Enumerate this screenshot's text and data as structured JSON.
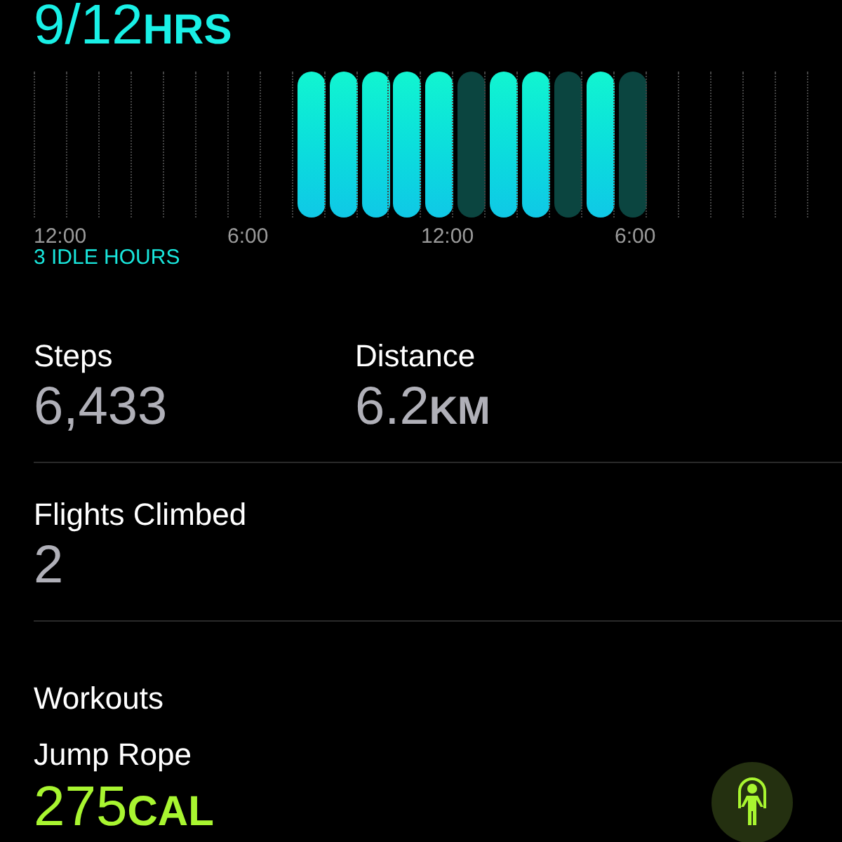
{
  "stand": {
    "value": "9/12",
    "unit": "HRS",
    "hours": [
      {
        "stood": false,
        "idle": false
      },
      {
        "stood": false,
        "idle": false
      },
      {
        "stood": false,
        "idle": false
      },
      {
        "stood": false,
        "idle": false
      },
      {
        "stood": false,
        "idle": false
      },
      {
        "stood": false,
        "idle": false
      },
      {
        "stood": false,
        "idle": false
      },
      {
        "stood": false,
        "idle": false
      },
      {
        "stood": true,
        "idle": false
      },
      {
        "stood": true,
        "idle": false
      },
      {
        "stood": true,
        "idle": false
      },
      {
        "stood": true,
        "idle": false
      },
      {
        "stood": true,
        "idle": false
      },
      {
        "stood": false,
        "idle": true
      },
      {
        "stood": true,
        "idle": false
      },
      {
        "stood": true,
        "idle": false
      },
      {
        "stood": false,
        "idle": true
      },
      {
        "stood": true,
        "idle": false
      },
      {
        "stood": false,
        "idle": true
      },
      {
        "stood": false,
        "idle": false
      },
      {
        "stood": false,
        "idle": false
      },
      {
        "stood": false,
        "idle": false
      },
      {
        "stood": false,
        "idle": false
      },
      {
        "stood": false,
        "idle": false
      }
    ],
    "axis_labels": [
      "12:00",
      "6:00",
      "12:00",
      "6:00"
    ],
    "idle_note": "3 IDLE HOURS"
  },
  "metrics": [
    {
      "label": "Steps",
      "value": "6,433"
    },
    {
      "label": "Distance",
      "value": "6.2",
      "unit": "KM"
    }
  ],
  "flights": {
    "label": "Flights Climbed",
    "value": "2"
  },
  "workouts": {
    "heading": "Workouts",
    "items": [
      {
        "name": "Jump Rope",
        "value": "275",
        "unit": "CAL"
      }
    ]
  }
}
